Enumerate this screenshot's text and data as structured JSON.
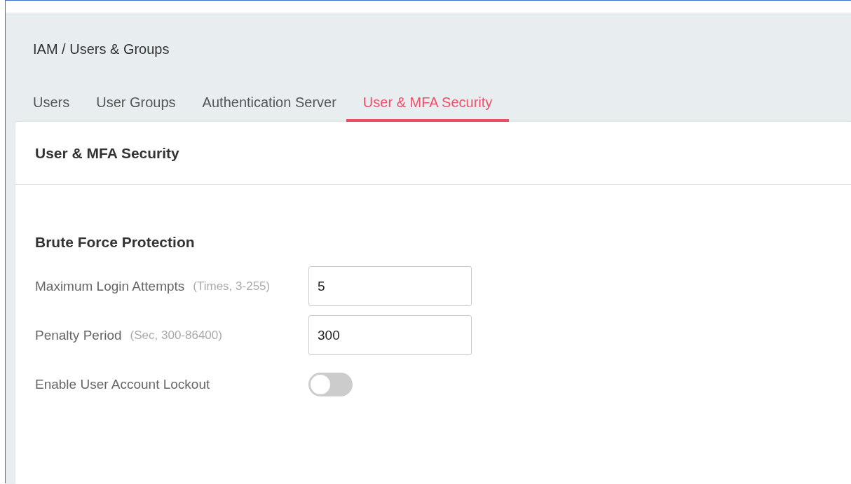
{
  "breadcrumb": "IAM / Users & Groups",
  "tabs": [
    {
      "label": "Users",
      "selected": false
    },
    {
      "label": "User Groups",
      "selected": false
    },
    {
      "label": "Authentication Server",
      "selected": false
    },
    {
      "label": "User & MFA Security",
      "selected": true
    }
  ],
  "panel": {
    "title": "User & MFA Security",
    "section": "Brute Force Protection",
    "fields": [
      {
        "kind": "input",
        "label": "Maximum Login Attempts",
        "hint": "(Times, 3-255)",
        "value": "5"
      },
      {
        "kind": "input",
        "label": "Penalty Period",
        "hint": "(Sec, 300-86400)",
        "value": "300"
      },
      {
        "kind": "toggle",
        "label": "Enable User Account Lockout",
        "on": false
      }
    ]
  }
}
